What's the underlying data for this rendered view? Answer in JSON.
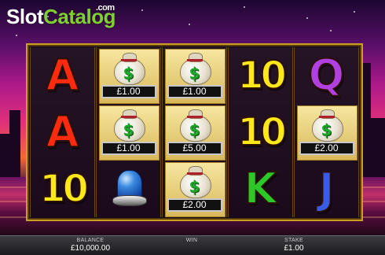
{
  "watermark": {
    "part1": "Slot",
    "part2": "Catalog",
    "suffix": ".com"
  },
  "colors": {
    "frame_gold": "#c9a020",
    "logo_green": "#7fd030",
    "ace_red": "#ff2a10",
    "ten_yellow": "#ffe81a",
    "queen_purple": "#b040e0",
    "king_green": "#2ac828",
    "jack_blue": "#3a5ae8"
  },
  "reels": [
    {
      "symbols": [
        {
          "type": "letter",
          "text": "A",
          "color": "#ff2a10",
          "icon": "ace-symbol"
        },
        {
          "type": "letter",
          "text": "A",
          "color": "#ff2a10",
          "icon": "ace-symbol"
        },
        {
          "type": "ten",
          "text": "10",
          "color": "#ffe81a",
          "icon": "ten-symbol"
        }
      ]
    },
    {
      "symbols": [
        {
          "type": "bag",
          "value": "£1.00",
          "icon": "money-bag-icon"
        },
        {
          "type": "bag",
          "value": "£1.00",
          "icon": "money-bag-icon"
        },
        {
          "type": "siren",
          "icon": "police-siren-icon"
        }
      ]
    },
    {
      "symbols": [
        {
          "type": "bag",
          "value": "£1.00",
          "icon": "money-bag-icon"
        },
        {
          "type": "bag",
          "value": "£5.00",
          "icon": "money-bag-icon"
        },
        {
          "type": "bag",
          "value": "£2.00",
          "icon": "money-bag-icon"
        }
      ]
    },
    {
      "symbols": [
        {
          "type": "ten",
          "text": "10",
          "color": "#ffe81a",
          "icon": "ten-symbol"
        },
        {
          "type": "ten",
          "text": "10",
          "color": "#ffe81a",
          "icon": "ten-symbol"
        },
        {
          "type": "letter",
          "text": "K",
          "color": "#2ac828",
          "icon": "king-symbol"
        }
      ]
    },
    {
      "symbols": [
        {
          "type": "letter",
          "text": "Q",
          "color": "#b040e0",
          "icon": "queen-symbol"
        },
        {
          "type": "bag",
          "value": "£2.00",
          "icon": "money-bag-icon"
        },
        {
          "type": "letter",
          "text": "J",
          "color": "#3a5ae8",
          "icon": "jack-symbol"
        }
      ]
    }
  ],
  "status": {
    "balance_label": "BALANCE",
    "balance_value": "£10,000.00",
    "win_label": "WIN",
    "win_value": "",
    "stake_label": "STAKE",
    "stake_value": "£1.00"
  }
}
